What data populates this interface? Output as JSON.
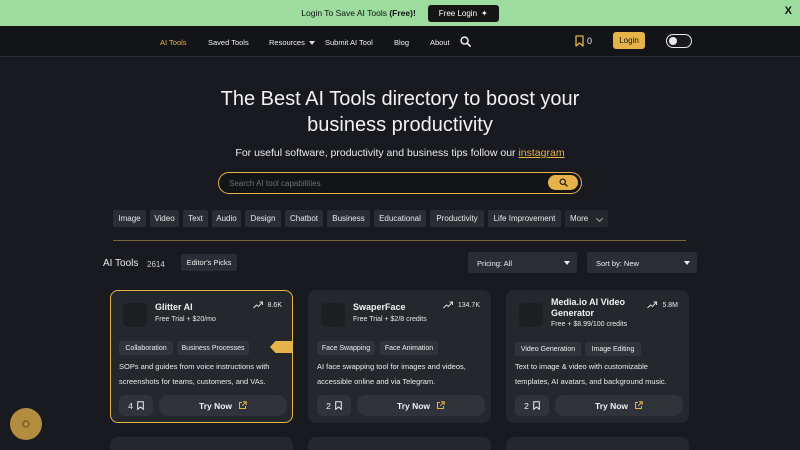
{
  "banner": {
    "prefix": "Login To Save AI Tools ",
    "bold": "(Free)!",
    "button": "Free Login",
    "close": "X"
  },
  "nav": {
    "items": [
      "AI Tools",
      "Saved Tools",
      "Resources",
      "Submit AI Tool",
      "Blog",
      "About"
    ],
    "active": "AI Tools",
    "bookmark_count": "0",
    "login": "Login"
  },
  "hero": {
    "headline_line1": "The Best AI Tools directory to boost your",
    "headline_line2": "business productivity",
    "sub_prefix": "For useful software, productivity and business tips follow our ",
    "sub_link": "instagram"
  },
  "search": {
    "placeholder": "Search AI tool capabilities"
  },
  "categories": [
    "Image",
    "Video",
    "Text",
    "Audio",
    "Design",
    "Chatbot",
    "Business",
    "Educational",
    "Productivity",
    "Life Improvement",
    "More"
  ],
  "list": {
    "label": "AI Tools",
    "count": "2614",
    "editors_picks": "Editor's Picks",
    "pricing": "Pricing: All",
    "sort": "Sort by: New"
  },
  "cards": [
    {
      "name": "Glitter AI",
      "price": "Free Trial + $20/mo",
      "stat": "8.6K",
      "tags": [
        "Collaboration",
        "Business Processes"
      ],
      "desc_line1": "SOPs and guides from voice instructions with",
      "desc_line2": "screenshots for teams, customers, and VAs.",
      "saves": "4",
      "cta": "Try Now"
    },
    {
      "name": "SwaperFace",
      "price": "Free Trial + $2/8 credits",
      "stat": "134.7K",
      "tags": [
        "Face Swapping",
        "Face Animation"
      ],
      "desc_line1": "AI face swapping tool for images and videos,",
      "desc_line2": "accessible online and via Telegram.",
      "saves": "2",
      "cta": "Try Now"
    },
    {
      "name_line1": "Media.io AI Video",
      "name_line2": "Generator",
      "price": "Free + $8.99/100 credits",
      "stat": "5.8M",
      "tags": [
        "Video Generation",
        "Image Editing"
      ],
      "desc_line1": "Text to image & video with customizable",
      "desc_line2": "templates, AI avatars, and background music.",
      "saves": "2",
      "cta": "Try Now"
    }
  ],
  "colors": {
    "accent": "#e6b24a",
    "banner": "#9cdc9e",
    "background": "#181a1f",
    "card": "#24272c"
  }
}
